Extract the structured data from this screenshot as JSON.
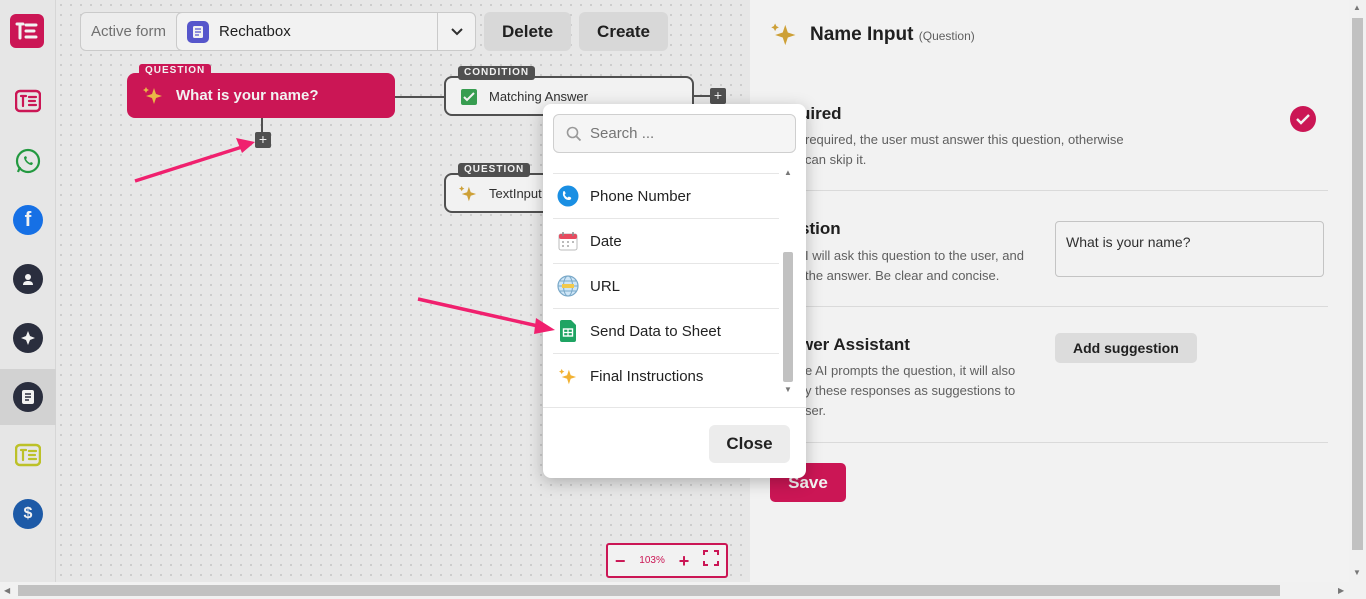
{
  "topbar": {
    "active_form_label": "Active form",
    "selected_form": "Rechatbox",
    "delete_label": "Delete",
    "create_label": "Create"
  },
  "nodes": {
    "question1": {
      "tag": "QUESTION",
      "title": "What is your name?"
    },
    "condition": {
      "tag": "CONDITION",
      "title": "Matching Answer"
    },
    "question2": {
      "tag": "QUESTION",
      "title": "TextInput"
    }
  },
  "zoom": {
    "level": "103%"
  },
  "panel": {
    "title": "Name Input",
    "subtitle": "(Question)",
    "required": {
      "heading": "uired",
      "desc1": "required, the user must answer this question, otherwise",
      "desc2": "can skip it."
    },
    "question": {
      "heading": "stion",
      "desc1": "I will ask this question to the user, and",
      "desc2": "the answer. Be clear and concise.",
      "value": "What is your name?"
    },
    "assistant": {
      "heading": "wer Assistant",
      "desc1": "e AI prompts the question, it will also",
      "desc2": "y these responses as suggestions to",
      "desc3": "ser.",
      "button": "Add suggestion"
    },
    "save_label": "Save"
  },
  "modal": {
    "search_placeholder": "Search ...",
    "items": [
      {
        "label": "Phone Number",
        "icon": "phone-icon"
      },
      {
        "label": "Date",
        "icon": "calendar-icon"
      },
      {
        "label": "URL",
        "icon": "globe-icon"
      },
      {
        "label": "Send Data to Sheet",
        "icon": "sheets-icon"
      },
      {
        "label": "Final Instructions",
        "icon": "sparkle-icon"
      }
    ],
    "close_label": "Close"
  },
  "colors": {
    "brand": "#d6185a",
    "node_dark": "#555555"
  }
}
